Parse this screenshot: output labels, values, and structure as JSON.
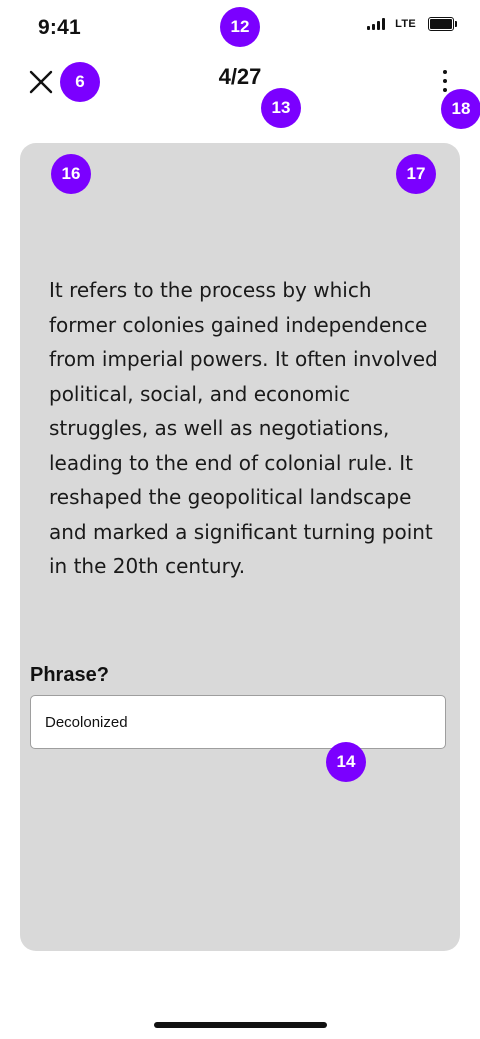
{
  "status_bar": {
    "time": "9:41",
    "network": "LTE",
    "battery_level": 1.0,
    "signal_bars": 4
  },
  "nav": {
    "counter": "4/27",
    "close_icon": "close-icon",
    "more_icon": "more-vertical-icon"
  },
  "markers": {
    "close": "6",
    "status": "12",
    "counter": "13",
    "input": "14",
    "card_left": "16",
    "card_right": "17",
    "more": "18"
  },
  "card": {
    "definition": "It refers to the process by which former colonies gained independence from imperial powers. It often involved political, social, and economic struggles, as well as negotiations, leading to the end of colonial rule. It reshaped the geopolitical landscape and marked a significant turning point in the 20th century.",
    "question_label": "Phrase?",
    "answer_value": "Decolonized"
  },
  "colors": {
    "marker": "#7b00ff",
    "card_background": "#d9d9d9"
  }
}
